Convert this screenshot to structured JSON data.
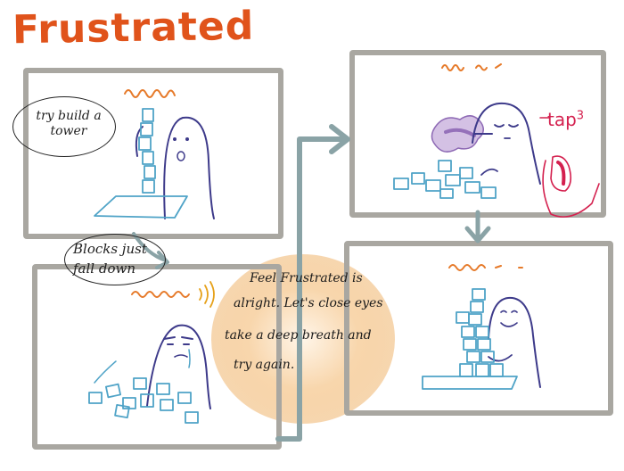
{
  "title": "Frustrated",
  "panel1": {
    "bubble_line1": "try build a",
    "bubble_line2": "tower"
  },
  "panel2": {
    "bubble_line1": "Blocks just",
    "bubble_line2": "fall down"
  },
  "panel3": {
    "tap_text": "tap",
    "tap_superscript": "3"
  },
  "advice": {
    "line1": "Feel Frustrated is",
    "line2": "alright. Let's close eyes",
    "line3": "take a deep breath and",
    "line4": "try again."
  },
  "colors": {
    "title": "#e0531b",
    "frame": "#a9a7a1",
    "blocks": "#4fa3c7",
    "character": "#3d3a8a",
    "tap": "#d4214f",
    "smoke": "#7a4fa8",
    "glow": "#f3c58d"
  }
}
